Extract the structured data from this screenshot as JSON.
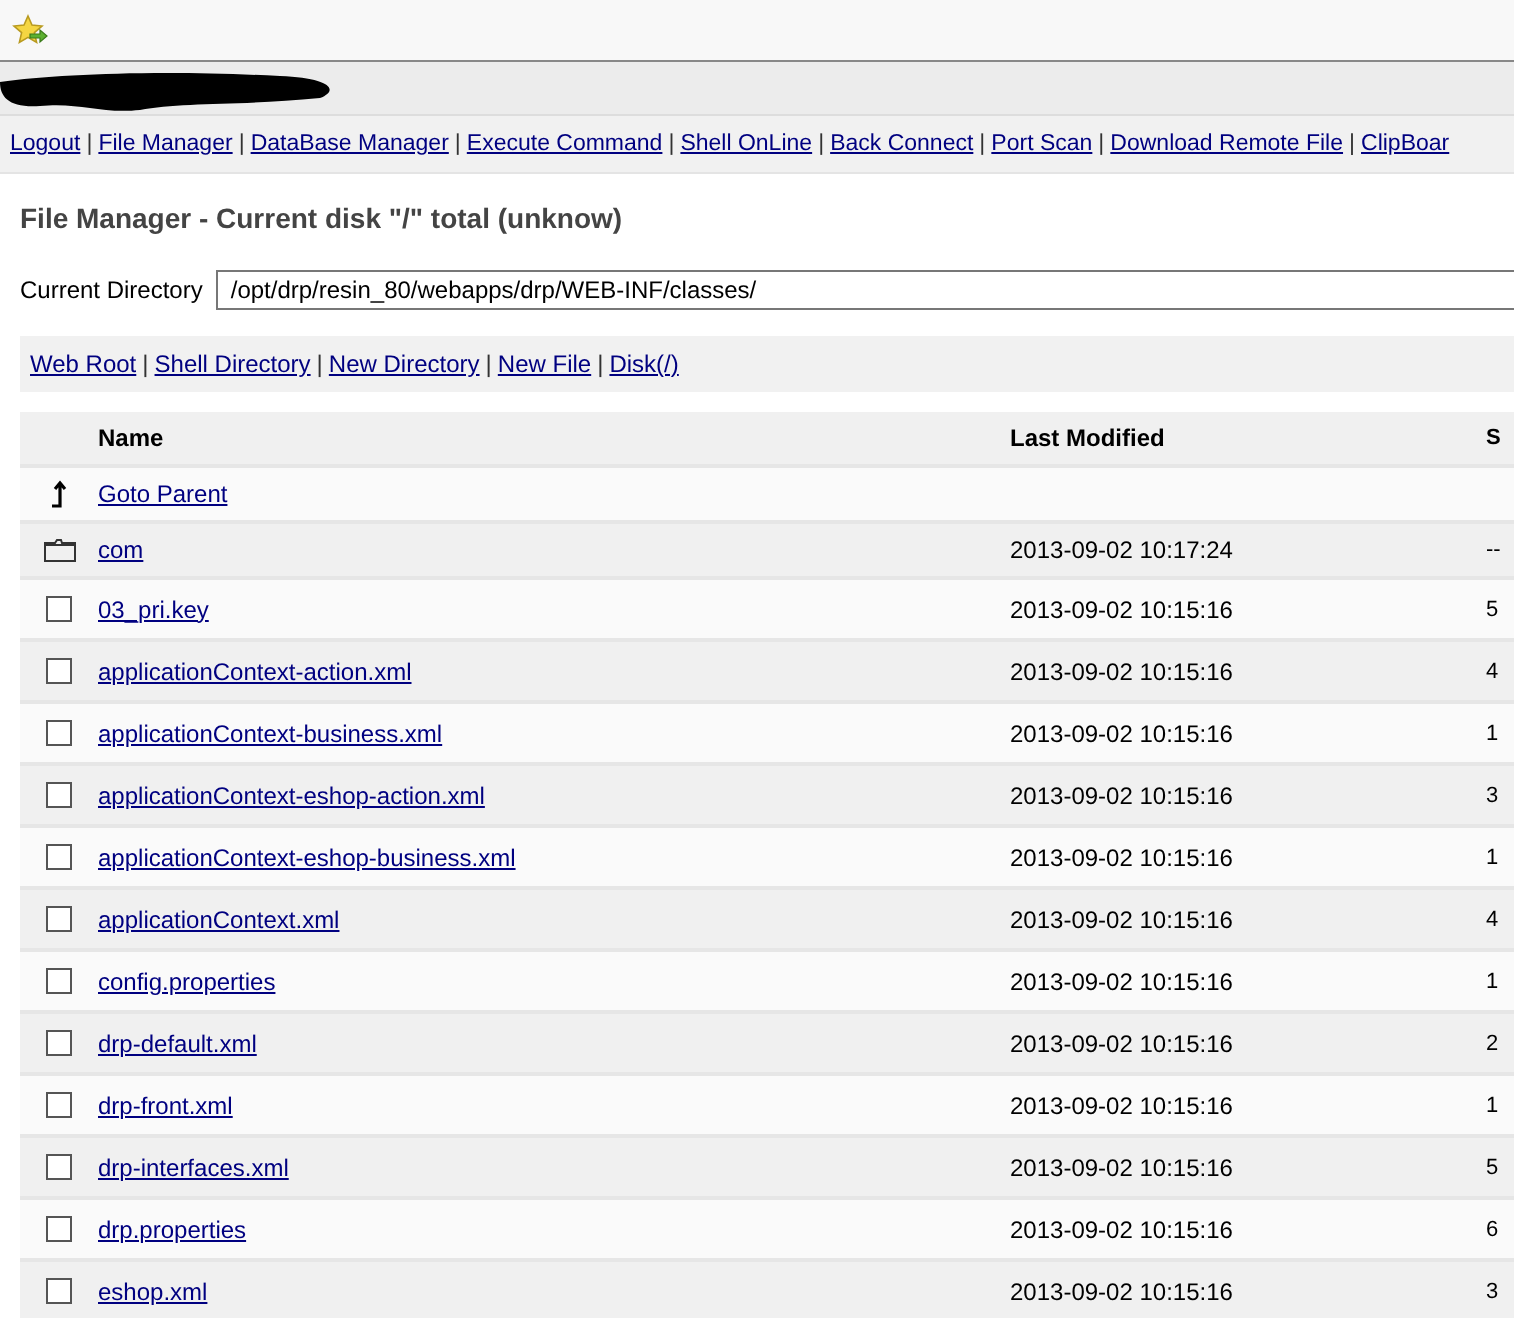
{
  "nav": [
    "Logout",
    "File Manager",
    "DataBase Manager",
    "Execute Command",
    "Shell OnLine",
    "Back Connect",
    "Port Scan",
    "Download Remote File",
    "ClipBoar"
  ],
  "separator": "|",
  "heading": "File Manager - Current disk \"/\" total (unknow)",
  "directory": {
    "label": "Current Directory",
    "value": "/opt/drp/resin_80/webapps/drp/WEB-INF/classes/"
  },
  "actions": [
    "Web Root",
    "Shell Directory",
    "New Directory",
    "New File",
    "Disk(/)"
  ],
  "table": {
    "columns": [
      "Name",
      "Last Modified",
      "S"
    ],
    "rows": [
      {
        "kind": "parent",
        "name": "Goto Parent"
      },
      {
        "kind": "dir",
        "name": "com",
        "modified": "2013-09-02 10:17:24",
        "column_3": "--"
      },
      {
        "kind": "file",
        "checked": false,
        "name": "03_pri.key",
        "modified": "2013-09-02 10:15:16",
        "column_3": "5"
      },
      {
        "kind": "file",
        "checked": false,
        "name": "applicationContext-action.xml",
        "modified": "2013-09-02 10:15:16",
        "column_3": "4"
      },
      {
        "kind": "file",
        "checked": false,
        "name": "applicationContext-business.xml",
        "modified": "2013-09-02 10:15:16",
        "column_3": "1"
      },
      {
        "kind": "file",
        "checked": false,
        "name": "applicationContext-eshop-action.xml",
        "modified": "2013-09-02 10:15:16",
        "column_3": "3"
      },
      {
        "kind": "file",
        "checked": false,
        "name": "applicationContext-eshop-business.xml",
        "modified": "2013-09-02 10:15:16",
        "column_3": "1"
      },
      {
        "kind": "file",
        "checked": false,
        "name": "applicationContext.xml",
        "modified": "2013-09-02 10:15:16",
        "column_3": "4"
      },
      {
        "kind": "file",
        "checked": false,
        "name": "config.properties",
        "modified": "2013-09-02 10:15:16",
        "column_3": "1"
      },
      {
        "kind": "file",
        "checked": false,
        "name": "drp-default.xml",
        "modified": "2013-09-02 10:15:16",
        "column_3": "2"
      },
      {
        "kind": "file",
        "checked": false,
        "name": "drp-front.xml",
        "modified": "2013-09-02 10:15:16",
        "column_3": "1"
      },
      {
        "kind": "file",
        "checked": false,
        "name": "drp-interfaces.xml",
        "modified": "2013-09-02 10:15:16",
        "column_3": "5"
      },
      {
        "kind": "file",
        "checked": false,
        "name": "drp.properties",
        "modified": "2013-09-02 10:15:16",
        "column_3": "6"
      },
      {
        "kind": "file",
        "checked": false,
        "name": "eshop.xml",
        "modified": "2013-09-02 10:15:16",
        "column_3": "3"
      }
    ]
  }
}
